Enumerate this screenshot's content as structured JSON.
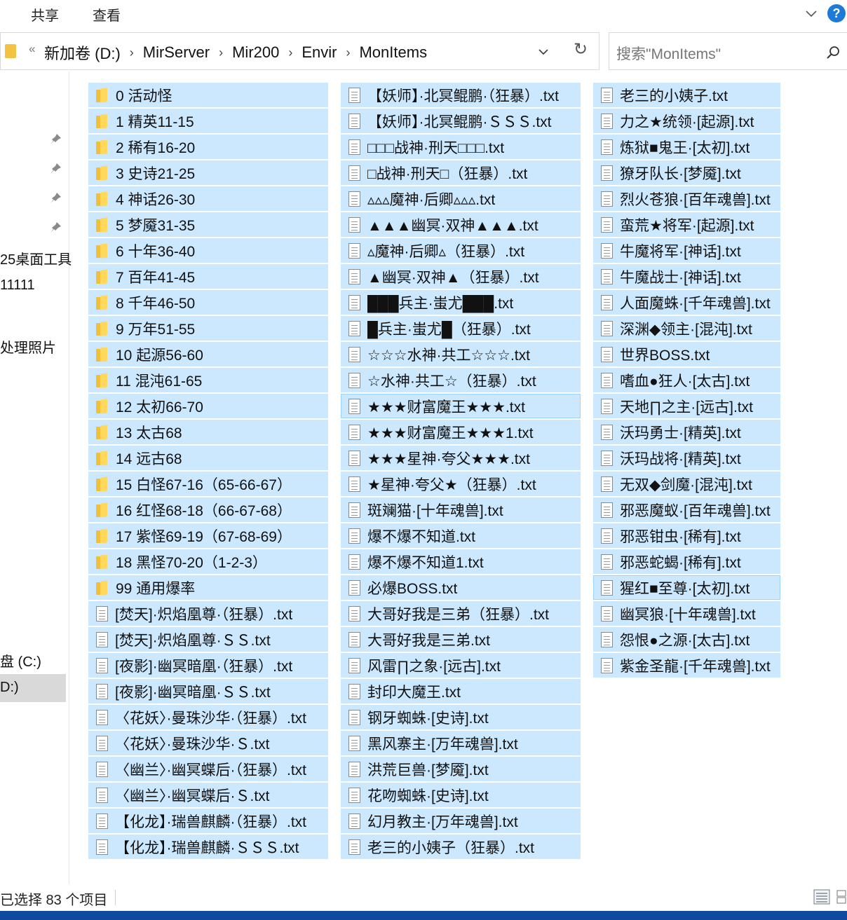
{
  "ribbon": {
    "tabs": [
      "共享",
      "查看"
    ]
  },
  "address": {
    "prefix": "«",
    "crumbs": [
      "新加卷 (D:)",
      "MirServer",
      "Mir200",
      "Envir",
      "MonItems"
    ],
    "separator": "›",
    "refresh_glyph": "↻"
  },
  "search": {
    "placeholder": "搜索\"MonItems\""
  },
  "nav": {
    "items": [
      "25桌面工具",
      "11111",
      "处理照片",
      "盘 (C:)",
      "D:)"
    ]
  },
  "columns": [
    [
      {
        "type": "folder",
        "name": "0   活动怪"
      },
      {
        "type": "folder",
        "name": "1   精英11-15"
      },
      {
        "type": "folder",
        "name": "2   稀有16-20"
      },
      {
        "type": "folder",
        "name": "3   史诗21-25"
      },
      {
        "type": "folder",
        "name": "4   神话26-30"
      },
      {
        "type": "folder",
        "name": "5   梦魇31-35"
      },
      {
        "type": "folder",
        "name": "6   十年36-40"
      },
      {
        "type": "folder",
        "name": "7   百年41-45"
      },
      {
        "type": "folder",
        "name": "8   千年46-50"
      },
      {
        "type": "folder",
        "name": "9   万年51-55"
      },
      {
        "type": "folder",
        "name": "10  起源56-60"
      },
      {
        "type": "folder",
        "name": "11  混沌61-65"
      },
      {
        "type": "folder",
        "name": "12  太初66-70"
      },
      {
        "type": "folder",
        "name": "13  太古68"
      },
      {
        "type": "folder",
        "name": "14  远古68"
      },
      {
        "type": "folder",
        "name": "15  白怪67-16（65-66-67）"
      },
      {
        "type": "folder",
        "name": "16  红怪68-18（66-67-68）"
      },
      {
        "type": "folder",
        "name": "17  紫怪69-19（67-68-69）"
      },
      {
        "type": "folder",
        "name": "18  黑怪70-20（1-2-3）"
      },
      {
        "type": "folder",
        "name": "99  通用爆率"
      },
      {
        "type": "file",
        "name": "[焚天]·炽焰凰尊·（狂暴）.txt"
      },
      {
        "type": "file",
        "name": "[焚天]·炽焰凰尊·ＳＳ.txt"
      },
      {
        "type": "file",
        "name": "[夜影]·幽冥暗凰·（狂暴）.txt"
      },
      {
        "type": "file",
        "name": "[夜影]·幽冥暗凰·ＳＳ.txt"
      },
      {
        "type": "file",
        "name": "〈花妖〉·曼珠沙华·（狂暴）.txt"
      },
      {
        "type": "file",
        "name": "〈花妖〉·曼珠沙华·Ｓ.txt"
      },
      {
        "type": "file",
        "name": "〈幽兰〉·幽冥蝶后·（狂暴）.txt"
      },
      {
        "type": "file",
        "name": "〈幽兰〉·幽冥蝶后·Ｓ.txt"
      },
      {
        "type": "file",
        "name": "【化龙】·瑞兽麒麟·（狂暴）.txt"
      },
      {
        "type": "file",
        "name": "【化龙】·瑞兽麒麟·ＳＳＳ.txt"
      }
    ],
    [
      {
        "type": "file",
        "name": "【妖师】·北冥鲲鹏·（狂暴）.txt"
      },
      {
        "type": "file",
        "name": "【妖师】·北冥鲲鹏·ＳＳＳ.txt"
      },
      {
        "type": "file",
        "name": "□□□战神·刑天□□□.txt"
      },
      {
        "type": "file",
        "name": "□战神·刑天□（狂暴）.txt"
      },
      {
        "type": "file",
        "name": "▵▵▵魔神·后卿▵▵▵.txt"
      },
      {
        "type": "file",
        "name": "▲▲▲幽冥·双神▲▲▲.txt"
      },
      {
        "type": "file",
        "name": "▵魔神·后卿▵（狂暴）.txt"
      },
      {
        "type": "file",
        "name": "▲幽冥·双神▲（狂暴）.txt"
      },
      {
        "type": "file",
        "name": "███兵主·蚩尤███.txt"
      },
      {
        "type": "file",
        "name": "█兵主·蚩尤█（狂暴）.txt"
      },
      {
        "type": "file",
        "name": "☆☆☆水神·共工☆☆☆.txt"
      },
      {
        "type": "file",
        "name": "☆水神·共工☆（狂暴）.txt"
      },
      {
        "type": "file",
        "name": "★★★财富魔王★★★.txt",
        "focus": true
      },
      {
        "type": "file",
        "name": "★★★财富魔王★★★1.txt"
      },
      {
        "type": "file",
        "name": "★★★星神·夸父★★★.txt"
      },
      {
        "type": "file",
        "name": "★星神·夸父★（狂暴）.txt"
      },
      {
        "type": "file",
        "name": "斑斓猫·[十年魂兽].txt"
      },
      {
        "type": "file",
        "name": "爆不爆不知道.txt"
      },
      {
        "type": "file",
        "name": "爆不爆不知道1.txt"
      },
      {
        "type": "file",
        "name": "必爆BOSS.txt"
      },
      {
        "type": "file",
        "name": "大哥好我是三弟（狂暴）.txt"
      },
      {
        "type": "file",
        "name": "大哥好我是三弟.txt"
      },
      {
        "type": "file",
        "name": "风雷∏之象·[远古].txt"
      },
      {
        "type": "file",
        "name": "封印大魔王.txt"
      },
      {
        "type": "file",
        "name": "钢牙蜘蛛·[史诗].txt"
      },
      {
        "type": "file",
        "name": "黑风寨主·[万年魂兽].txt"
      },
      {
        "type": "file",
        "name": "洪荒巨兽·[梦魇].txt"
      },
      {
        "type": "file",
        "name": "花吻蜘蛛·[史诗].txt"
      },
      {
        "type": "file",
        "name": "幻月教主·[万年魂兽].txt"
      },
      {
        "type": "file",
        "name": "老三的小姨子（狂暴）.txt"
      }
    ],
    [
      {
        "type": "file",
        "name": "老三的小姨子.txt"
      },
      {
        "type": "file",
        "name": "力之★统领·[起源].txt"
      },
      {
        "type": "file",
        "name": "炼狱■鬼王·[太初].txt"
      },
      {
        "type": "file",
        "name": "獠牙队长·[梦魇].txt"
      },
      {
        "type": "file",
        "name": "烈火苍狼·[百年魂兽].txt"
      },
      {
        "type": "file",
        "name": "蛮荒★将军·[起源].txt"
      },
      {
        "type": "file",
        "name": "牛魔将军·[神话].txt"
      },
      {
        "type": "file",
        "name": "牛魔战士·[神话].txt"
      },
      {
        "type": "file",
        "name": "人面魔蛛·[千年魂兽].txt"
      },
      {
        "type": "file",
        "name": "深渊◆领主·[混沌].txt"
      },
      {
        "type": "file",
        "name": "世界BOSS.txt"
      },
      {
        "type": "file",
        "name": "嗜血●狂人·[太古].txt"
      },
      {
        "type": "file",
        "name": "天地∏之主·[远古].txt"
      },
      {
        "type": "file",
        "name": "沃玛勇士·[精英].txt"
      },
      {
        "type": "file",
        "name": "沃玛战将·[精英].txt"
      },
      {
        "type": "file",
        "name": "无双◆剑魔·[混沌].txt"
      },
      {
        "type": "file",
        "name": "邪恶魔蚁·[百年魂兽].txt"
      },
      {
        "type": "file",
        "name": "邪恶钳虫·[稀有].txt"
      },
      {
        "type": "file",
        "name": "邪恶蛇蝎·[稀有].txt"
      },
      {
        "type": "file",
        "name": "猩红■至尊·[太初].txt",
        "focus": true
      },
      {
        "type": "file",
        "name": "幽冥狼·[十年魂兽].txt"
      },
      {
        "type": "file",
        "name": "怨恨●之源·[太古].txt"
      },
      {
        "type": "file",
        "name": "紫金圣龍·[千年魂兽].txt"
      }
    ]
  ],
  "status": {
    "text": "已选择 83 个项目"
  },
  "colors": {
    "selection": "#cce8ff",
    "folder": "#f3bf3a",
    "taskbar": "#0f4a9e"
  }
}
